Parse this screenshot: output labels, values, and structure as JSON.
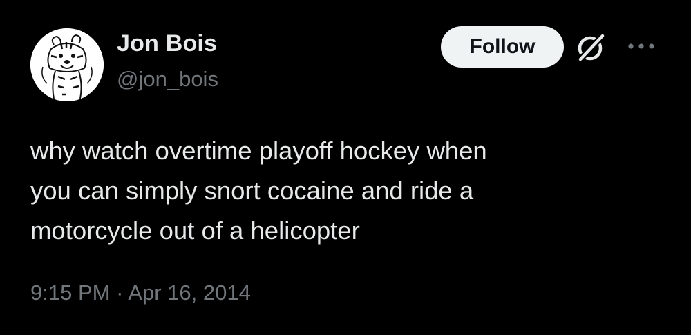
{
  "author": {
    "display_name": "Jon Bois",
    "handle": "@jon_bois"
  },
  "actions": {
    "follow_label": "Follow",
    "grok_icon": "grok-slash-icon",
    "more_icon": "more-dots-icon"
  },
  "tweet": {
    "lines": [
      "why watch overtime playoff hockey when",
      "you can simply snort cocaine and ride a",
      "motorcycle out of a helicopter"
    ]
  },
  "meta": {
    "time": "9:15 PM",
    "separator": "·",
    "date": "Apr 16, 2014"
  },
  "colors": {
    "background": "#000000",
    "primary_text": "#e7e9ea",
    "secondary_text": "#71767b",
    "follow_bg": "#eff3f4",
    "follow_text": "#0f1419"
  }
}
